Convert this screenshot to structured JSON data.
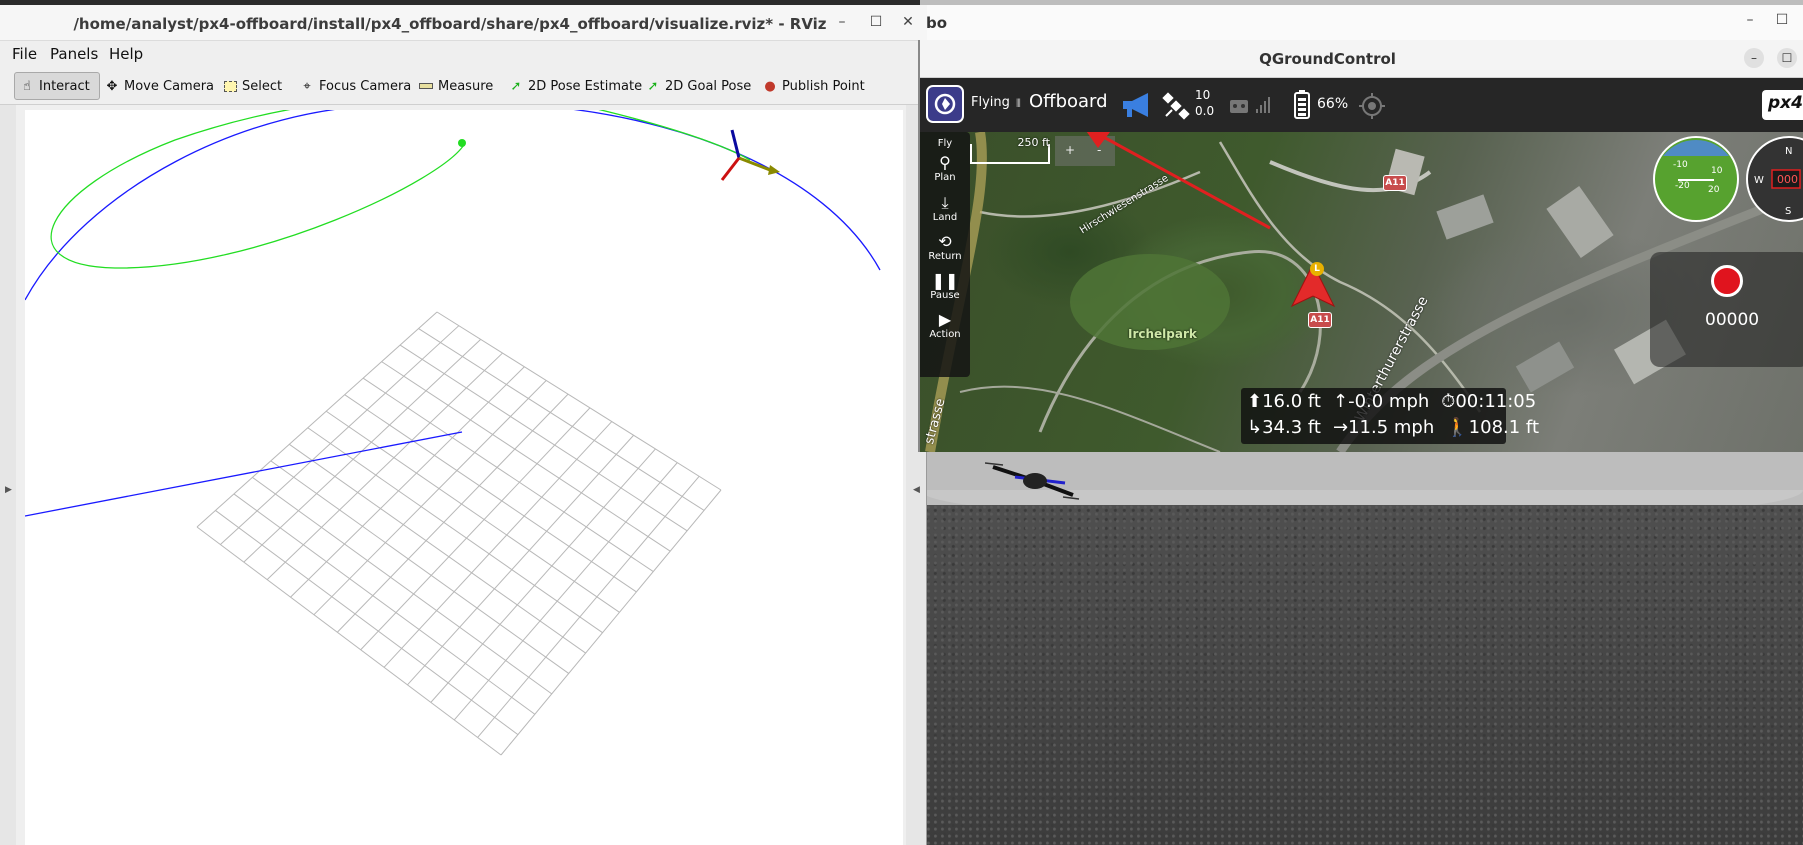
{
  "gazebo": {
    "title": "bo",
    "controls": [
      "–",
      "☐",
      "✕"
    ]
  },
  "rviz": {
    "title": "/home/analyst/px4-offboard/install/px4_offboard/share/px4_offboard/visualize.rviz* - RViz",
    "window_controls": {
      "minimize": "–",
      "maximize": "☐",
      "close": "✕"
    },
    "menu": {
      "file": "File",
      "panels": "Panels",
      "help": "Help"
    },
    "tools": {
      "interact": "Interact",
      "move_camera": "Move Camera",
      "select": "Select",
      "focus_camera": "Focus Camera",
      "measure": "Measure",
      "pose_estimate": "2D Pose Estimate",
      "goal_pose": "2D Goal Pose",
      "publish_point": "Publish Point"
    },
    "colors": {
      "trajectory": "#00e000",
      "path": "#0000ff",
      "grid": "#a0a0a0"
    }
  },
  "qgc": {
    "title": "QGroundControl",
    "window_controls": {
      "minimize": "–",
      "maximize": "☐"
    },
    "flight_state": "Flying",
    "flight_mode": "Offboard",
    "satellites": {
      "count": "10",
      "hdop": "0.0"
    },
    "battery": "66%",
    "brand": "px4",
    "scale_label": "250 ft",
    "zoom": {
      "in": "+",
      "out": "-"
    },
    "tools": [
      {
        "label": "Fly",
        "icon": "fly-icon"
      },
      {
        "label": "Plan",
        "icon": "plan-icon"
      },
      {
        "label": "Land",
        "icon": "land-icon"
      },
      {
        "label": "Return",
        "icon": "return-icon"
      },
      {
        "label": "Pause",
        "icon": "pause-icon"
      },
      {
        "label": "Action",
        "icon": "action-icon"
      }
    ],
    "map_labels": {
      "park": "Irchelpark",
      "street1": "Hirschwiesenstrasse",
      "street2": "Winterthurerstrasse",
      "street3": "strasse",
      "sign": "A11"
    },
    "vehicle_marker": "L",
    "telemetry": {
      "altitude": "16.0 ft",
      "vertical_speed": "-0.0 mph",
      "flight_time": "00:11:05",
      "distance": "34.3 ft",
      "ground_speed": "11.5 mph",
      "distance_to_home": "108.1 ft"
    },
    "recording_counter": "00000",
    "compass_heading": "000",
    "attitude_ticks": [
      "-10",
      "10",
      "-20",
      "20"
    ],
    "compass_letters": {
      "n": "N",
      "w": "W",
      "s": "S"
    },
    "colors": {
      "header": "#262626",
      "flying": "#ffffff",
      "record": "#e0141e",
      "arrow": "#e02020"
    }
  }
}
